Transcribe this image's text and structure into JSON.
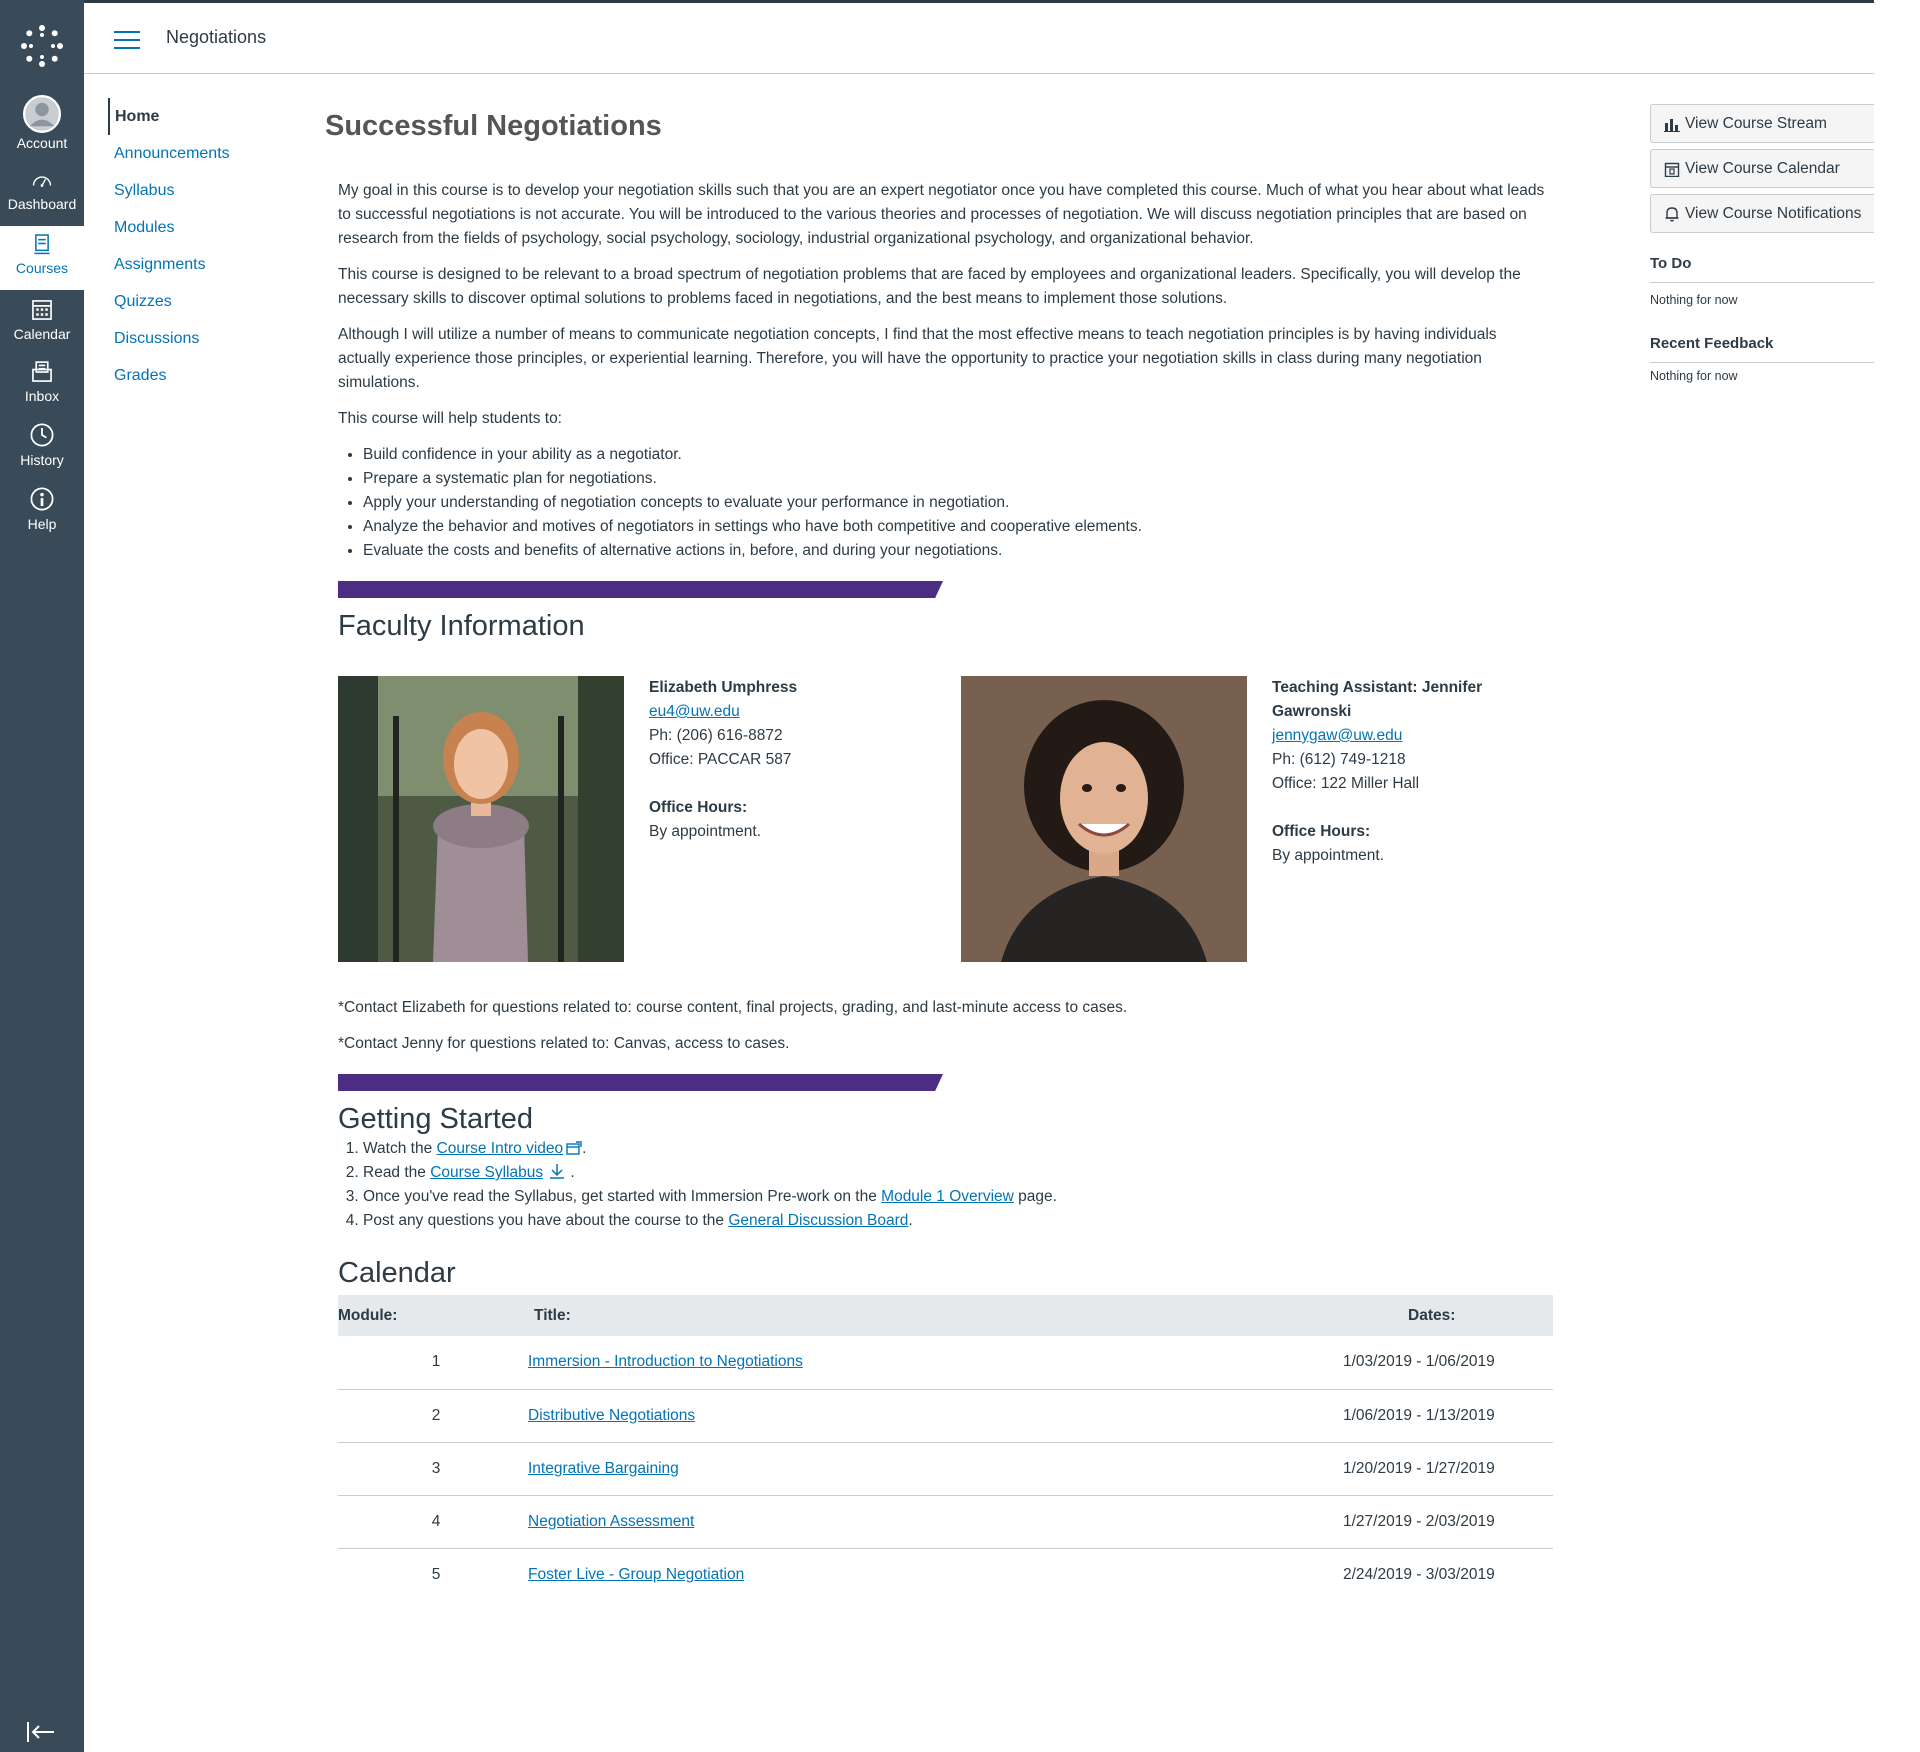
{
  "global_nav": {
    "items": [
      {
        "label": "Account",
        "icon": "account-icon"
      },
      {
        "label": "Dashboard",
        "icon": "dashboard-icon"
      },
      {
        "label": "Courses",
        "icon": "courses-icon"
      },
      {
        "label": "Calendar",
        "icon": "calendar-icon"
      },
      {
        "label": "Inbox",
        "icon": "inbox-icon"
      },
      {
        "label": "History",
        "icon": "history-icon"
      },
      {
        "label": "Help",
        "icon": "help-icon"
      }
    ],
    "active": "Courses",
    "colors": {
      "bg": "#394b58",
      "active_text": "#0374b5"
    }
  },
  "header": {
    "breadcrumb": "Negotiations"
  },
  "course_nav": {
    "items": [
      "Home",
      "Announcements",
      "Syllabus",
      "Modules",
      "Assignments",
      "Quizzes",
      "Discussions",
      "Grades"
    ],
    "active": "Home"
  },
  "main": {
    "title": "Successful Negotiations",
    "intro": [
      "My goal in this course is to develop your negotiation skills such that you are an expert negotiator once you have completed this course. Much of what you hear about what leads to successful negotiations is not accurate. You will be introduced to the various theories and processes of negotiation. We will discuss negotiation principles that are based on research from the fields of psychology, social psychology, sociology, industrial organizational psychology, and organizational behavior.",
      "This course is designed to be relevant to a broad spectrum of negotiation problems that are faced by employees and organizational leaders. Specifically, you will develop the necessary skills to discover optimal solutions to problems faced in negotiations, and the best means to implement those solutions.",
      "Although I will utilize a number of means to communicate negotiation concepts, I find that the most effective means to teach negotiation principles is by having individuals actually experience those principles, or experiential learning. Therefore, you will have the opportunity to practice your negotiation skills in class during many negotiation simulations.",
      "This course will help students to:"
    ],
    "goals": [
      "Build confidence in your ability as a negotiator.",
      "Prepare a systematic plan for negotiations.",
      "Apply your understanding of negotiation concepts to evaluate your performance in negotiation.",
      "Analyze the behavior and motives of negotiators in settings who have both competitive and cooperative elements.",
      "Evaluate the costs and benefits of alternative actions in, before, and during your negotiations."
    ],
    "faculty_heading": "Faculty Information",
    "faculty": [
      {
        "name": "Elizabeth Umphress",
        "email": "eu4@uw.edu",
        "phone": "Ph: (206) 616-8872",
        "office": "Office: PACCAR 587",
        "hours_label": "Office Hours:",
        "hours": "By appointment."
      },
      {
        "name": "Teaching Assistant: Jennifer Gawronski",
        "email": "jennygaw@uw.edu",
        "phone": "Ph: (612) 749-1218",
        "office": "Office: 122 Miller Hall",
        "hours_label": "Office Hours:",
        "hours": "By appointment."
      }
    ],
    "contact_notes": [
      "*Contact Elizabeth for questions related to: course content, final projects, grading, and last-minute access to cases.",
      "*Contact Jenny for questions related to: Canvas, access to cases."
    ],
    "getting_started_heading": "Getting Started",
    "steps": [
      {
        "pre": "Watch the ",
        "link": "Course Intro video",
        "post": "."
      },
      {
        "pre": "Read the ",
        "link": "Course Syllabus",
        "post": " ."
      },
      {
        "pre": "Once you've read the Syllabus, get started with Immersion Pre-work on the ",
        "link": "Module 1 Overview",
        "post": " page."
      },
      {
        "pre": "Post any questions you have about the course to the ",
        "link": "General Discussion Board",
        "post": "."
      }
    ],
    "calendar_heading": "Calendar",
    "calendar": {
      "headers": [
        "Module:",
        "Title:",
        "Dates:"
      ],
      "rows": [
        {
          "module": "1",
          "title": "Immersion - Introduction to Negotiations",
          "dates": "1/03/2019 - 1/06/2019"
        },
        {
          "module": "2",
          "title": "Distributive Negotiations",
          "dates": "1/06/2019 - 1/13/2019"
        },
        {
          "module": "3",
          "title": "Integrative Bargaining",
          "dates": "1/20/2019 - 1/27/2019"
        },
        {
          "module": "4",
          "title": "Negotiation Assessment",
          "dates": "1/27/2019 - 2/03/2019"
        },
        {
          "module": "5",
          "title": "Foster Live - Group Negotiation",
          "dates": "2/24/2019 - 3/03/2019"
        }
      ]
    },
    "accent_color": "#4b2e83",
    "link_color": "#0374b5"
  },
  "aside": {
    "buttons": [
      "View Course Stream",
      "View Course Calendar",
      "View Course Notifications"
    ],
    "todo_heading": "To Do",
    "todo_text": "Nothing for now",
    "feedback_heading": "Recent Feedback",
    "feedback_text": "Nothing for now"
  }
}
